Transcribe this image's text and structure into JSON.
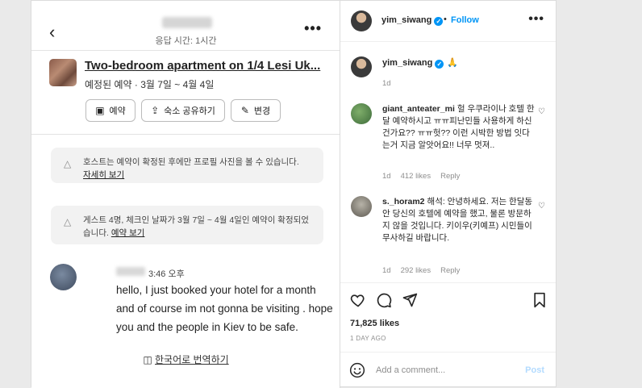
{
  "photo": {
    "response_time": "응답 시간: 1시간",
    "listing": {
      "title": "Two-bedroom apartment on 1/4 Lesi Uk...",
      "subtitle": "예정된 예약 · 3월 7일 ~ 4월 4일"
    },
    "buttons": [
      {
        "label": "예약",
        "icon": "briefcase-icon"
      },
      {
        "label": "숙소 공유하기",
        "icon": "share-icon"
      },
      {
        "label": "변경",
        "icon": "pencil-icon"
      }
    ],
    "notice1": {
      "text": "호스트는 예약이 확정된 후에만 프로필 사진을 볼 수 있습니다.",
      "link": "자세히 보기"
    },
    "notice2": {
      "text": "게스트 4명, 체크인 날짜가 3월 7일 ~ 4월 4일인 예약이 확정되었습니다.",
      "link": "예약 보기"
    },
    "message": {
      "time": "3:46 오후",
      "body": "hello, I just booked your hotel for a month and of course im not gonna be visiting . hope you and the people in Kiev to be safe."
    },
    "translate_label": "한국어로 번역하기"
  },
  "side": {
    "header": {
      "username": "yim_siwang",
      "follow_label": "Follow"
    },
    "caption": {
      "username": "yim_siwang",
      "emoji": "🙏",
      "time": "1d"
    },
    "comments": [
      {
        "username": "giant_anteater_mi",
        "text": "헐 우쿠라이나 호텔 한달 예약하시고 ㅠㅠ피난민들 사용하게 하신건가요?? ㅠㅠ헛?? 이런 시박한 방법 잇다는거 지금 알앗어요!! 너무 멋져..",
        "time": "1d",
        "likes": "412 likes",
        "reply": "Reply"
      },
      {
        "username": "s._horam2",
        "text": "해석: 안녕하세요. 저는 한달동안 당신의 호텔에 예약을 했고, 물론 방문하지 않을 것입니다. 키이우(키예프) 시민들이 무사하길 바랍니다.",
        "time": "1d",
        "likes": "292 likes",
        "reply": "Reply"
      }
    ],
    "likes_count": "71,825 likes",
    "time_ago": "1 DAY AGO",
    "add_comment_placeholder": "Add a comment...",
    "post_label": "Post"
  },
  "colors": {
    "accent": "#0095f6",
    "post_disabled": "#b3dbff",
    "muted": "#8e8e8e"
  }
}
